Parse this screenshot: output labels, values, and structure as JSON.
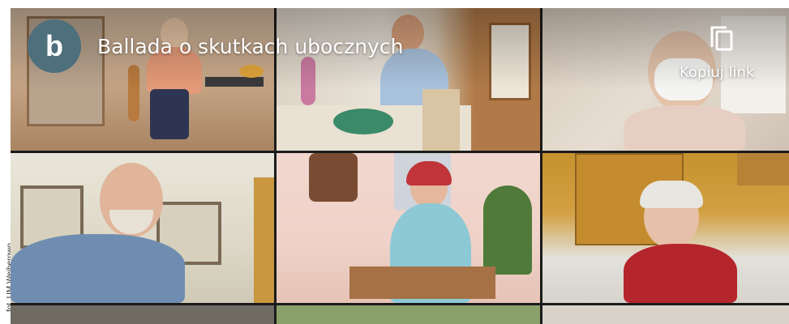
{
  "photo_credit": "fot. UM Wejherowo",
  "video": {
    "channel_initial": "b",
    "title": "Ballada o skutkach ubocznych",
    "copy_link_label": "Kopiuj link",
    "copy_icon": "copy-icon",
    "accent": "#4e6f7c"
  }
}
